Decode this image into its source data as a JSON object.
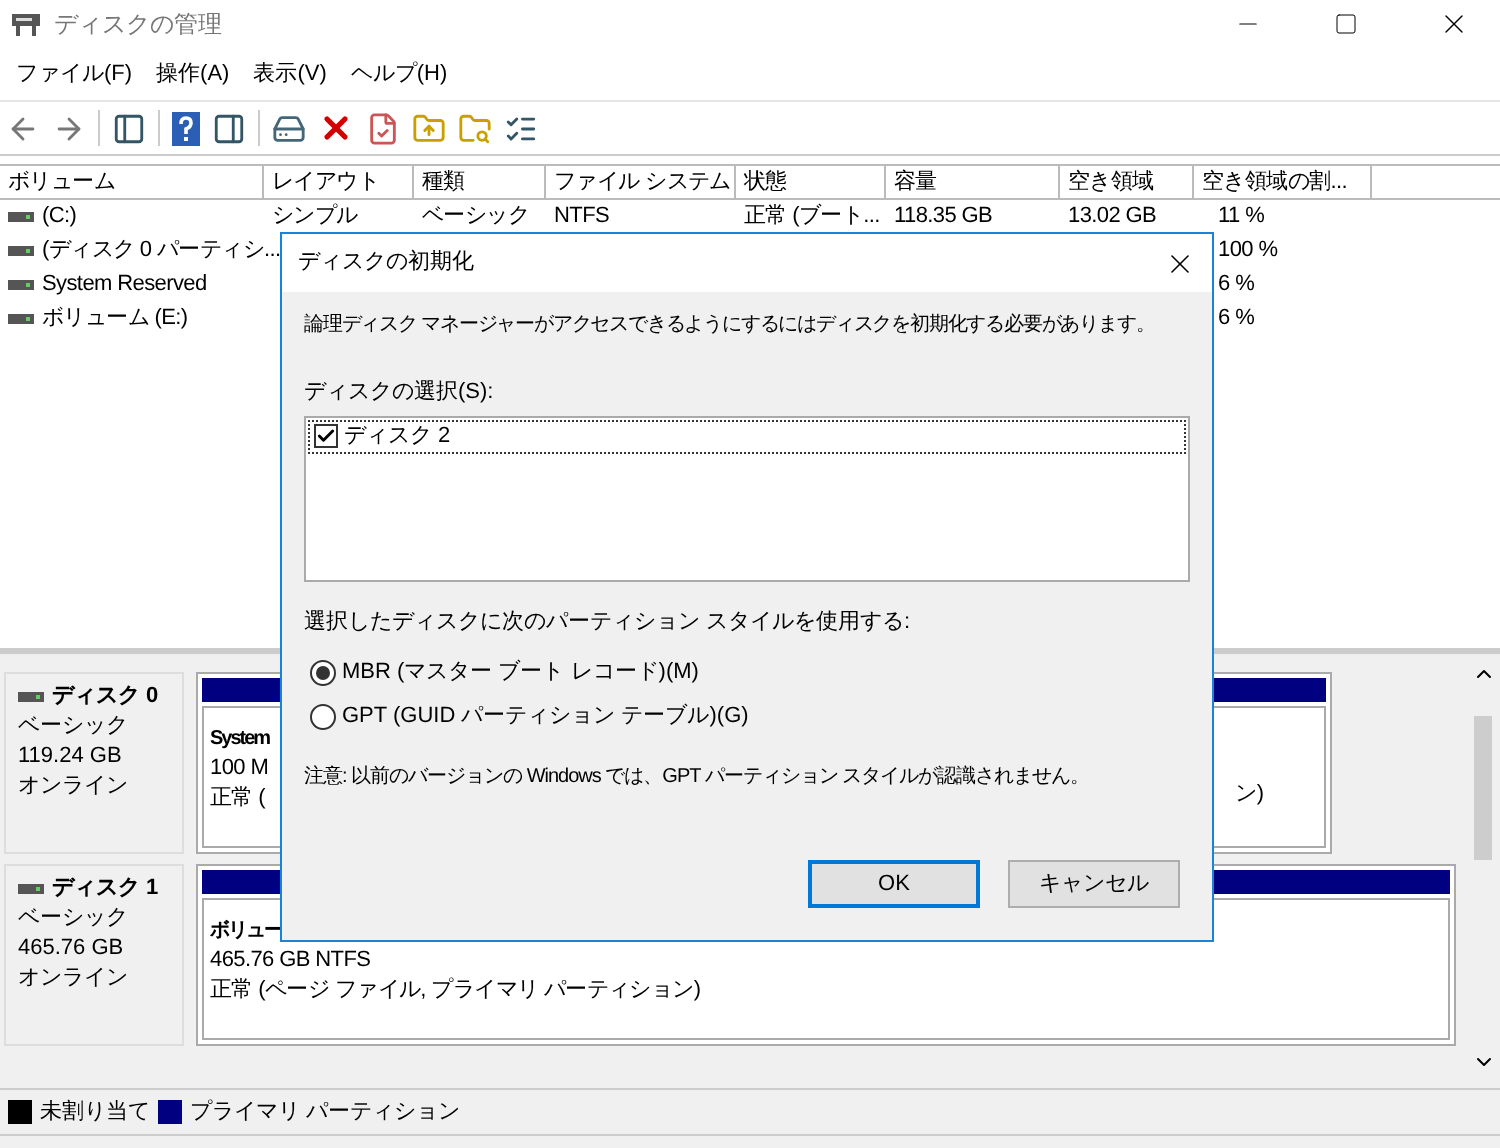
{
  "window": {
    "title": "ディスクの管理"
  },
  "menu": [
    "ファイル(F)",
    "操作(A)",
    "表示(V)",
    "ヘルプ(H)"
  ],
  "volume_table": {
    "columns": [
      "ボリューム",
      "レイアウト",
      "種類",
      "ファイル システム",
      "状態",
      "容量",
      "空き領域",
      "空き領域の割..."
    ],
    "rows": [
      [
        "(C:)",
        "シンプル",
        "ベーシック",
        "NTFS",
        "正常 (ブート...",
        "118.35 GB",
        "13.02 GB",
        "11 %"
      ],
      [
        "(ディスク 0 パーティシ...",
        null,
        null,
        null,
        null,
        null,
        null,
        "100 %"
      ],
      [
        "System Reserved",
        null,
        null,
        null,
        null,
        null,
        null,
        "6 %"
      ],
      [
        "ボリューム (E:)",
        null,
        null,
        null,
        null,
        null,
        null,
        "6 %"
      ]
    ]
  },
  "disks": [
    {
      "name": "ディスク 0",
      "type": "ベーシック",
      "size": "119.24 GB",
      "status": "オンライン",
      "partition": {
        "lines": [
          "System",
          "100 M",
          "正常 ("
        ],
        "right_fragment": "ン)"
      }
    },
    {
      "name": "ディスク 1",
      "type": "ベーシック",
      "size": "465.76 GB",
      "status": "オンライン",
      "partition": {
        "lines": [
          "ボリュー",
          "465.76 GB NTFS",
          "正常 (ページ ファイル, プライマリ パーティション)"
        ]
      }
    }
  ],
  "legend": [
    {
      "label": "未割り当て",
      "color": "#000000"
    },
    {
      "label": "プライマリ パーティション",
      "color": "#000080"
    }
  ],
  "dialog": {
    "title": "ディスクの初期化",
    "message": "論理ディスク マネージャーがアクセスできるようにするにはディスクを初期化する必要があります。",
    "select_label": "ディスクの選択(S):",
    "disks": [
      {
        "label": "ディスク 2",
        "checked": true
      }
    ],
    "style_label": "選択したディスクに次のパーティション スタイルを使用する:",
    "options": [
      {
        "label": "MBR (マスター ブート レコード)(M)",
        "selected": true
      },
      {
        "label": "GPT (GUID パーティション テーブル)(G)",
        "selected": false
      }
    ],
    "note": "注意: 以前のバージョンの Windows では、GPT パーティション スタイルが認識されません。",
    "buttons": [
      {
        "label": "OK",
        "default": true
      },
      {
        "label": "キャンセル",
        "default": false
      }
    ]
  }
}
